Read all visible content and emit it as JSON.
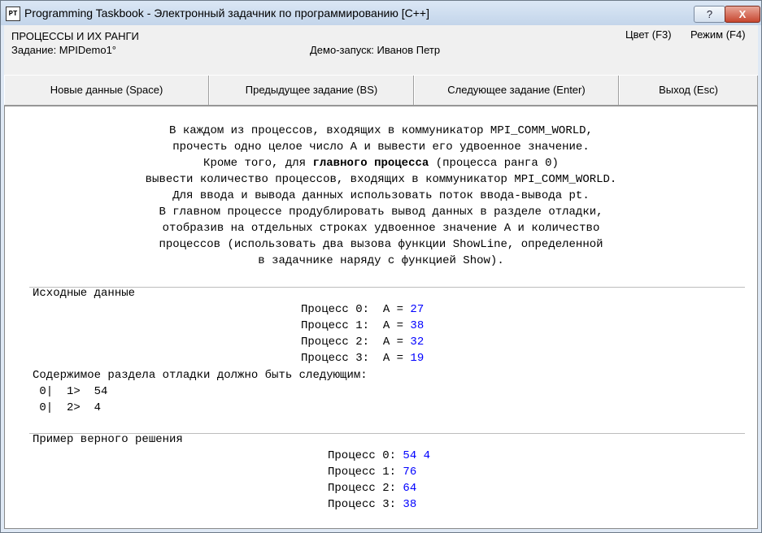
{
  "window": {
    "title": "Programming Taskbook - Электронный задачник по программированию [C++]",
    "icon_text": "PT",
    "help_button": "?",
    "close_button": "X"
  },
  "header": {
    "group_name": "ПРОЦЕССЫ И ИХ РАНГИ",
    "task_label": "Задание: MPIDemo1°",
    "demo_label": "Демо-запуск: Иванов Петр",
    "color_menu": "Цвет (F3)",
    "mode_menu": "Режим (F4)"
  },
  "toolbar": {
    "new_data": "Новые данные (Space)",
    "prev_task": "Предыдущее задание (BS)",
    "next_task": "Следующее задание (Enter)",
    "exit": "Выход (Esc)"
  },
  "task": {
    "line1": "В каждом из процессов, входящих в коммуникатор MPI_COMM_WORLD,",
    "line2": "прочесть одно целое число A и вывести его удвоенное значение.",
    "line3_pre": "Кроме того, для ",
    "line3_bold": "главного процесса",
    "line3_post": " (процесса ранга 0)",
    "line4": "вывести количество процессов, входящих в коммуникатор MPI_COMM_WORLD.",
    "line5": "Для ввода и вывода данных использовать поток ввода-вывода pt.",
    "line6": "В главном процессе продублировать вывод данных в разделе отладки,",
    "line7": "отобразив на отдельных строках удвоенное значение A и количество",
    "line8": "процессов (использовать два вызова функции ShowLine, определенной",
    "line9": "в задачнике наряду с функцией Show)."
  },
  "input_section": {
    "heading": "Исходные данные",
    "rows": [
      {
        "label": "Процесс 0:  A = ",
        "value": "27"
      },
      {
        "label": "Процесс 1:  A = ",
        "value": "38"
      },
      {
        "label": "Процесс 2:  A = ",
        "value": "32"
      },
      {
        "label": "Процесс 3:  A = ",
        "value": "19"
      }
    ],
    "debug_heading": "Содержимое раздела отладки должно быть следующим:",
    "debug_lines": [
      " 0|  1>  54",
      " 0|  2>  4"
    ]
  },
  "output_section": {
    "heading": "Пример верного решения",
    "rows": [
      {
        "label": "Процесс 0: ",
        "value": "54 4"
      },
      {
        "label": "Процесс 1: ",
        "value": "76"
      },
      {
        "label": "Процесс 2: ",
        "value": "64"
      },
      {
        "label": "Процесс 3: ",
        "value": "38"
      }
    ]
  },
  "colors": {
    "value_text": "#0000ff",
    "panel_bg": "#ffffff",
    "window_bg": "#f0f0f0"
  }
}
